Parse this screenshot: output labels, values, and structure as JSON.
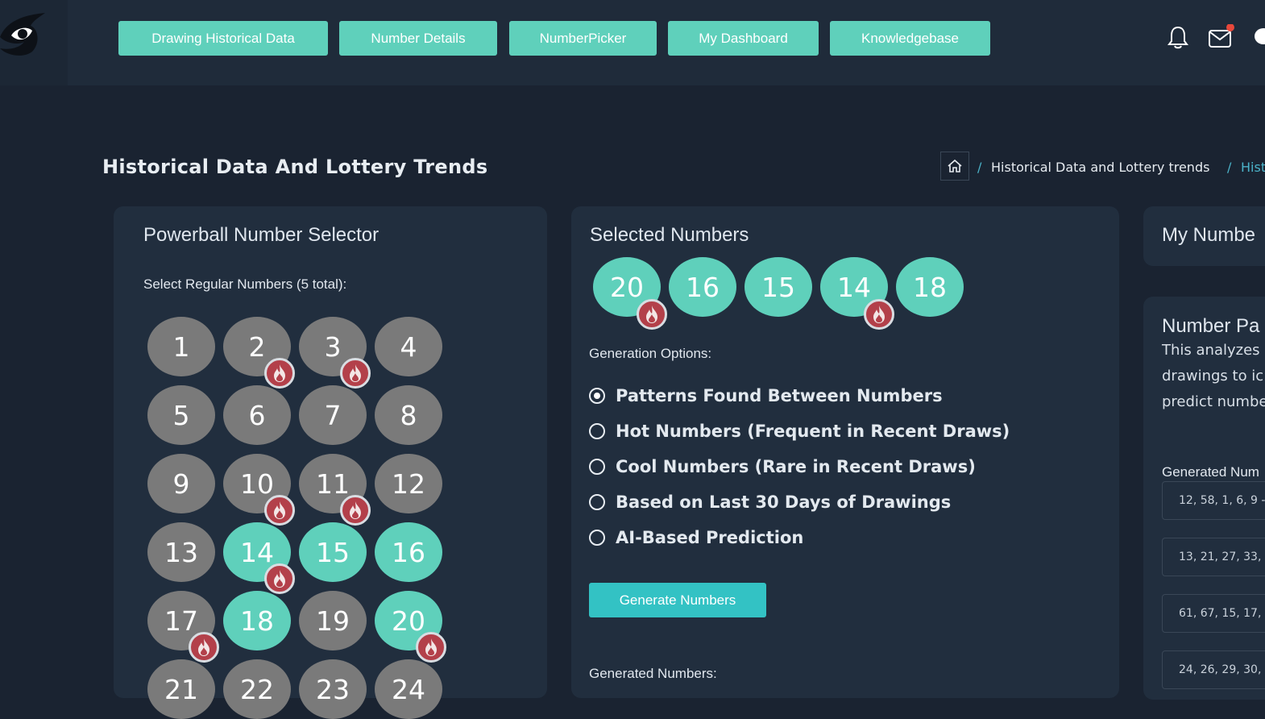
{
  "nav": {
    "items": [
      "Drawing Historical Data",
      "Number Details",
      "NumberPicker",
      "My Dashboard",
      "Knowledgebase"
    ]
  },
  "icons": {
    "logo": "brand-logo",
    "notifications": "bell-icon",
    "messages": "mail-icon",
    "chat": "chat-icon",
    "home": "home-icon",
    "hot": "fire-icon"
  },
  "colors": {
    "accent": "#5fd0bb",
    "button": "#33c2c4",
    "ball_unselected": "#7a7a7a",
    "hot_badge": "#b3404a",
    "notification_dot": "#e8483b"
  },
  "header": {
    "title": "Historical Data And Lottery Trends",
    "breadcrumb": [
      "Historical Data and Lottery trends",
      "Hist"
    ]
  },
  "selector": {
    "title": "Powerball Number Selector",
    "instruction": "Select Regular Numbers (5 total):",
    "numbers": [
      {
        "n": "1",
        "selected": false,
        "hot": false
      },
      {
        "n": "2",
        "selected": false,
        "hot": true
      },
      {
        "n": "3",
        "selected": false,
        "hot": true
      },
      {
        "n": "4",
        "selected": false,
        "hot": false
      },
      {
        "n": "5",
        "selected": false,
        "hot": false
      },
      {
        "n": "6",
        "selected": false,
        "hot": false
      },
      {
        "n": "7",
        "selected": false,
        "hot": false
      },
      {
        "n": "8",
        "selected": false,
        "hot": false
      },
      {
        "n": "9",
        "selected": false,
        "hot": false
      },
      {
        "n": "10",
        "selected": false,
        "hot": true
      },
      {
        "n": "11",
        "selected": false,
        "hot": true
      },
      {
        "n": "12",
        "selected": false,
        "hot": false
      },
      {
        "n": "13",
        "selected": false,
        "hot": false
      },
      {
        "n": "14",
        "selected": true,
        "hot": true
      },
      {
        "n": "15",
        "selected": true,
        "hot": false
      },
      {
        "n": "16",
        "selected": true,
        "hot": false
      },
      {
        "n": "17",
        "selected": false,
        "hot": true
      },
      {
        "n": "18",
        "selected": true,
        "hot": false
      },
      {
        "n": "19",
        "selected": false,
        "hot": false
      },
      {
        "n": "20",
        "selected": true,
        "hot": true
      },
      {
        "n": "21",
        "selected": false,
        "hot": false
      },
      {
        "n": "22",
        "selected": false,
        "hot": false
      },
      {
        "n": "23",
        "selected": false,
        "hot": false
      },
      {
        "n": "24",
        "selected": false,
        "hot": false
      }
    ]
  },
  "selected": {
    "title": "Selected Numbers",
    "numbers": [
      {
        "n": "20",
        "hot": true
      },
      {
        "n": "16",
        "hot": false
      },
      {
        "n": "15",
        "hot": false
      },
      {
        "n": "14",
        "hot": true
      },
      {
        "n": "18",
        "hot": false
      }
    ],
    "options_label": "Generation Options:",
    "options": [
      "Patterns Found Between Numbers",
      "Hot Numbers (Frequent in Recent Draws)",
      "Cool Numbers (Rare in Recent Draws)",
      "Based on Last 30 Days of Drawings",
      "AI-Based Prediction"
    ],
    "selected_option": 0,
    "generate_button": "Generate Numbers",
    "generated_label": "Generated Numbers:"
  },
  "right_panel": {
    "my_numbers_title": "My Numbe",
    "patterns_title": "Number Pa",
    "description_lines": [
      "This analyzes",
      "drawings to ic",
      "predict numbe"
    ],
    "generated_label": "Generated Num",
    "generated": [
      "12, 58, 1, 6, 9 -",
      "13, 21, 27, 33, 4",
      "61, 67, 15, 17,",
      "24, 26, 29, 30,"
    ]
  }
}
